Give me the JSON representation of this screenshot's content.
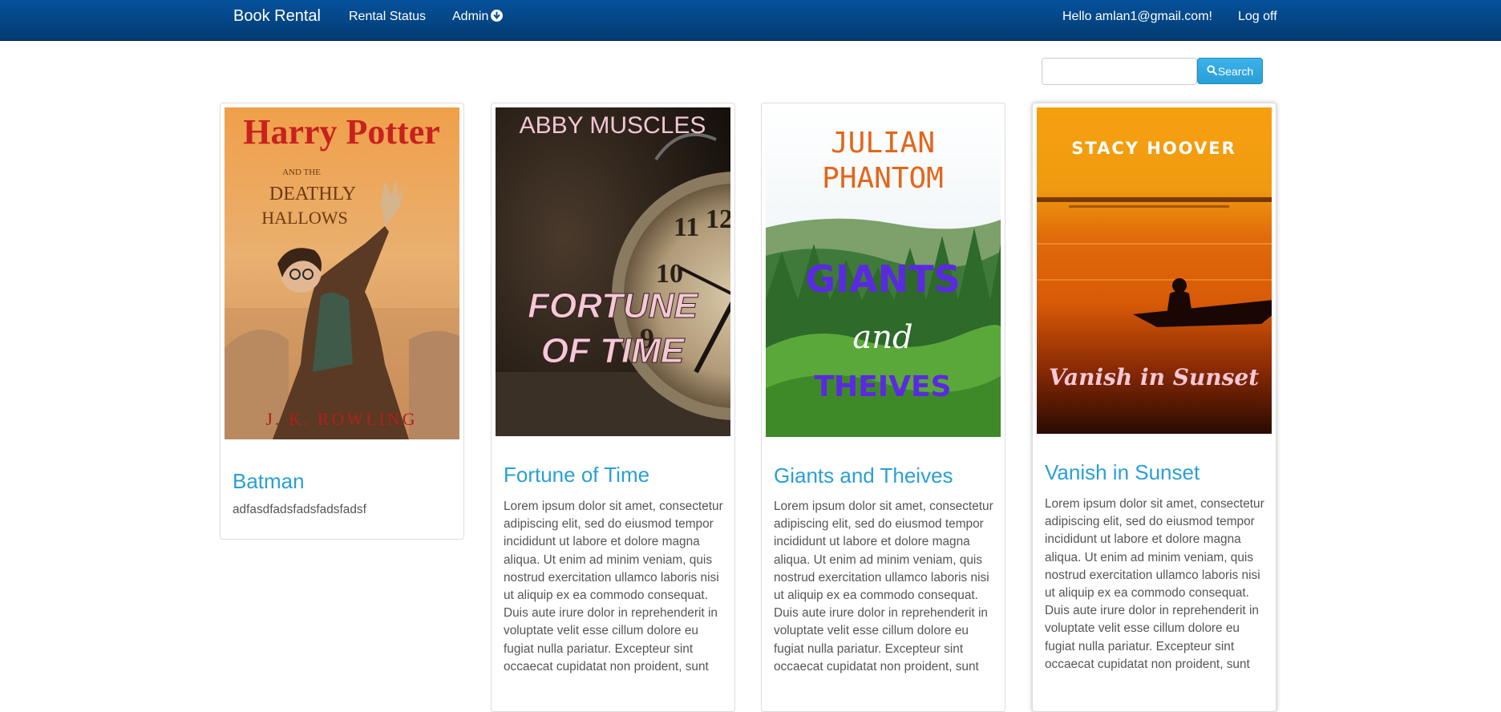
{
  "navbar": {
    "brand": "Book Rental",
    "rental_status": "Rental Status",
    "admin": "Admin",
    "greeting": "Hello amlan1@gmail.com!",
    "logoff": "Log off"
  },
  "search": {
    "placeholder": "",
    "button_label": "Search"
  },
  "colors": {
    "navbar": "#04519b",
    "accent": "#2a9fd6"
  },
  "books": [
    {
      "title": "Batman",
      "description": "adfasdfadsfadsfadsfadsf",
      "cover": {
        "title_line1": "Harry Potter",
        "title_line2": "AND THE",
        "title_line3": "DEATHLY",
        "title_line4": "HALLOWS",
        "author": "J. K. ROWLING"
      }
    },
    {
      "title": "Fortune of Time",
      "description": "Lorem ipsum dolor sit amet, consectetur adipiscing elit, sed do eiusmod tempor incididunt ut labore et dolore magna aliqua. Ut enim ad minim veniam, quis nostrud exercitation ullamco laboris nisi ut aliquip ex ea commodo consequat. Duis aute irure dolor in reprehenderit in voluptate velit esse cillum dolore eu fugiat nulla pariatur. Excepteur sint occaecat cupidatat non proident, sunt",
      "cover": {
        "author": "ABBY MUSCLES",
        "title_line1": "FORTUNE",
        "title_line2": "OF TIME"
      }
    },
    {
      "title": "Giants and Theives",
      "description": "Lorem ipsum dolor sit amet, consectetur adipiscing elit, sed do eiusmod tempor incididunt ut labore et dolore magna aliqua. Ut enim ad minim veniam, quis nostrud exercitation ullamco laboris nisi ut aliquip ex ea commodo consequat. Duis aute irure dolor in reprehenderit in voluptate velit esse cillum dolore eu fugiat nulla pariatur. Excepteur sint occaecat cupidatat non proident, sunt",
      "cover": {
        "author_line1": "JULIAN",
        "author_line2": "PHANTOM",
        "title_line1": "GIANTS",
        "title_line2": "and",
        "title_line3": "THEIVES"
      }
    },
    {
      "title": "Vanish in Sunset",
      "description": "Lorem ipsum dolor sit amet, consectetur adipiscing elit, sed do eiusmod tempor incididunt ut labore et dolore magna aliqua. Ut enim ad minim veniam, quis nostrud exercitation ullamco laboris nisi ut aliquip ex ea commodo consequat. Duis aute irure dolor in reprehenderit in voluptate velit esse cillum dolore eu fugiat nulla pariatur. Excepteur sint occaecat cupidatat non proident, sunt",
      "cover": {
        "author": "STACY HOOVER",
        "title": "Vanish in Sunset"
      }
    }
  ]
}
